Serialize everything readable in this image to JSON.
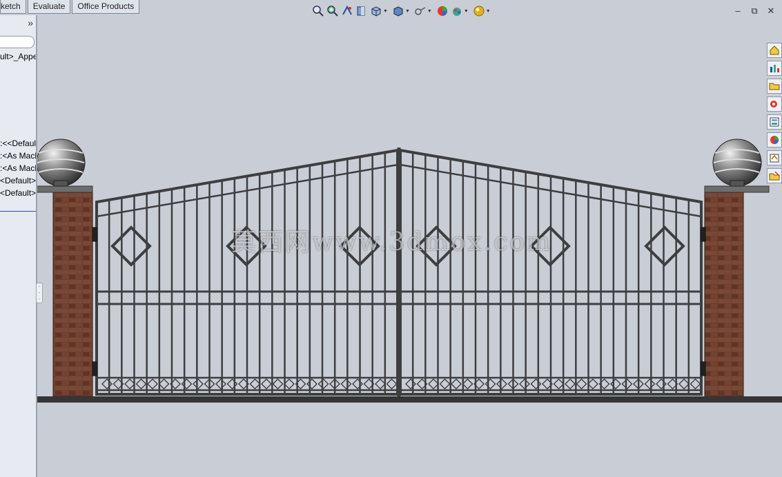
{
  "tabs": [
    {
      "label": "ketch"
    },
    {
      "label": "Evaluate"
    },
    {
      "label": "Office Products"
    }
  ],
  "feature_tree": {
    "expand_glyph": "»",
    "rows": [
      {
        "label": "ult>_Appe"
      },
      {
        "label": ":<<Defaul"
      },
      {
        "label": ":<As Macl"
      },
      {
        "label": ":<As Macl"
      },
      {
        "label": "<Default>"
      },
      {
        "label": "<Default>"
      }
    ]
  },
  "view_toolbar": {
    "icons": [
      "zoom-to-fit-icon",
      "zoom-to-area-icon",
      "previous-view-icon",
      "section-view-icon",
      "view-orientation-icon",
      "display-style-icon",
      "hide-show-items-icon",
      "edit-appearance-icon",
      "apply-scene-icon",
      "view-settings-icon"
    ]
  },
  "window_controls": {
    "minimize": "–",
    "restore": "⧉",
    "close": "✕"
  },
  "task_pane": {
    "icons": [
      "home-icon",
      "design-library-icon",
      "file-explorer-icon",
      "search-icon",
      "view-palette-icon",
      "appearances-icon",
      "custom-properties-icon",
      "recent-folder-icon"
    ]
  },
  "watermark": {
    "text": "莫西网www.3dmox.com"
  },
  "colors": {
    "background": "#c9cdd6",
    "iron": "#3e3e3e",
    "brick": "#6b3e2e",
    "cap": "#6d6d6d"
  }
}
